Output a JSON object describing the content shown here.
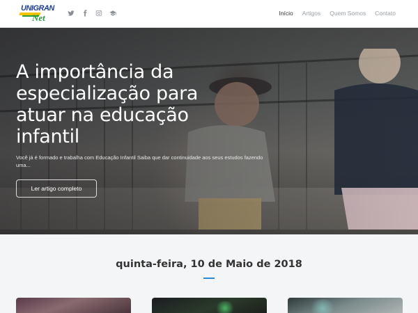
{
  "header": {
    "logo_text": "UNIGRAN",
    "logo_sub": "Net",
    "social_icons": [
      "twitter-icon",
      "facebook-icon",
      "instagram-icon",
      "graduation-cap-icon"
    ],
    "nav": [
      {
        "label": "Início",
        "active": true
      },
      {
        "label": "Artigos",
        "active": false
      },
      {
        "label": "Quem Somos",
        "active": false
      },
      {
        "label": "Contato",
        "active": false
      }
    ]
  },
  "hero": {
    "title": "A importância da especialização para atuar na educação infantil",
    "subtitle": "Você já é formado e trabalha com Educação Infantil Saiba que dar continuidade aos seus estudos fazendo uma...",
    "button_label": "Ler artigo completo"
  },
  "section": {
    "date": "quinta-feira, 10 de Maio de 2018",
    "accent_color": "#2b8ad6"
  }
}
